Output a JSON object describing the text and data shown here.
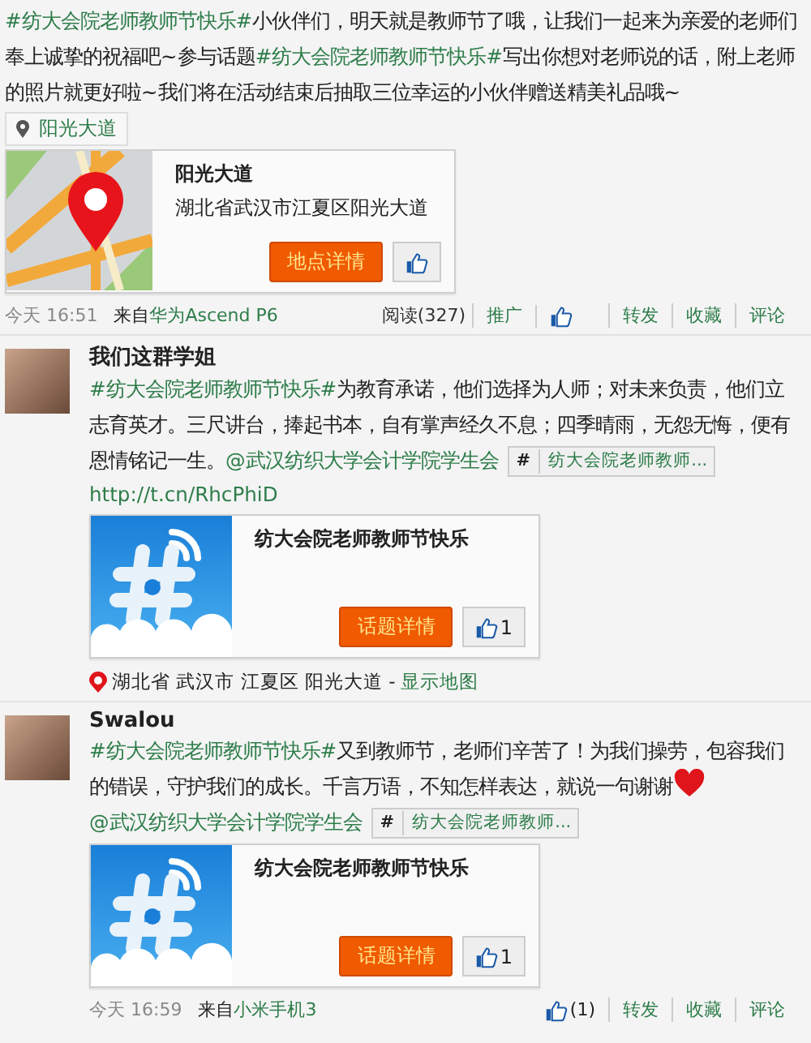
{
  "posts": [
    {
      "text": [
        {
          "kind": "topic",
          "text": "#纺大会院老师教师节快乐#"
        },
        {
          "kind": "text",
          "text": "小伙伴们，明天就是教师节了哦，让我们一起来为亲爱的老师们奉上诚挚的祝福吧~参与话题"
        },
        {
          "kind": "topic",
          "text": "#纺大会院老师教师节快乐#"
        },
        {
          "kind": "text",
          "text": "写出你想对老师说的话，附上老师的照片就更好啦~我们将在活动结束后抽取三位幸运的小伙伴赠送精美礼品哦~"
        }
      ],
      "location_tag": "阳光大道",
      "card": {
        "kind": "place",
        "title": "阳光大道",
        "subtitle": "湖北省武汉市江夏区阳光大道",
        "button": "地点详情"
      },
      "footer": {
        "time": "今天 16:51",
        "source_prefix": "来自",
        "source": "华为Ascend P6",
        "actions": [
          {
            "kind": "read",
            "label": "阅读(327)"
          },
          {
            "kind": "link",
            "label": "推广"
          },
          {
            "kind": "like"
          },
          {
            "kind": "link",
            "label": "转发"
          },
          {
            "kind": "link",
            "label": "收藏"
          },
          {
            "kind": "link",
            "label": "评论"
          }
        ]
      }
    },
    {
      "author": "我们这群学姐",
      "text": [
        {
          "kind": "topic",
          "text": "#纺大会院老师教师节快乐#"
        },
        {
          "kind": "text",
          "text": "为教育承诺，他们选择为人师；对未来负责，他们立志育英才。三尺讲台，捧起书本，自有掌声经久不息；四季晴雨，无怨无悔，便有恩情铭记一生。"
        },
        {
          "kind": "mention",
          "text": "@武汉纺织大学会计学院学生会"
        }
      ],
      "topic_chip": {
        "hash": "#",
        "label": "纺大会院老师教师..."
      },
      "url": "http://t.cn/RhcPhiD",
      "card": {
        "kind": "topic",
        "title": "纺大会院老师教师节快乐",
        "button": "话题详情",
        "likes": "1"
      },
      "location": {
        "text": "湖北省 武汉市 江夏区 阳光大道 -",
        "link": "显示地图"
      }
    },
    {
      "author": "Swalou",
      "text": [
        {
          "kind": "topic",
          "text": "#纺大会院老师教师节快乐#"
        },
        {
          "kind": "text",
          "text": "又到教师节，老师们辛苦了！为我们操劳，包容我们的错误，守护我们的成长。千言万语，不知怎样表达，就说一句谢谢"
        },
        {
          "kind": "heart"
        },
        {
          "kind": "mention",
          "text": "@武汉纺织大学会计学院学生会"
        }
      ],
      "topic_chip": {
        "hash": "#",
        "label": "纺大会院老师教师..."
      },
      "card": {
        "kind": "topic",
        "title": "纺大会院老师教师节快乐",
        "button": "话题详情",
        "likes": "1"
      },
      "footer": {
        "time": "今天 16:59",
        "source_prefix": "来自",
        "source": "小米手机3",
        "actions": [
          {
            "kind": "like",
            "label": "(1)"
          },
          {
            "kind": "link",
            "label": "转发"
          },
          {
            "kind": "link",
            "label": "收藏"
          },
          {
            "kind": "link",
            "label": "评论"
          }
        ]
      }
    }
  ]
}
